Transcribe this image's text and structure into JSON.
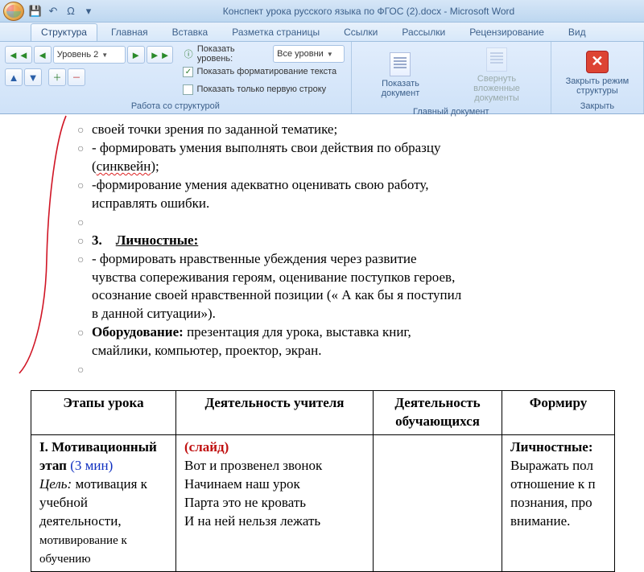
{
  "title": "Конспект урока русского языка по ФГОС (2).docx - Microsoft Word",
  "qat": {
    "save": "💾",
    "undo": "↶",
    "redo": "Ω",
    "dd": "▾"
  },
  "tabs": [
    "Структура",
    "Главная",
    "Вставка",
    "Разметка страницы",
    "Ссылки",
    "Рассылки",
    "Рецензирование",
    "Вид"
  ],
  "ribbon": {
    "outline_level": "Уровень 2",
    "show_level_label": "Показать уровень:",
    "show_level_value": "Все уровни",
    "show_formatting": "Показать форматирование текста",
    "first_line_only": "Показать только первую строку",
    "group_tools": "Работа со структурой",
    "show_doc": "Показать документ",
    "collapse": "Свернуть вложенные документы",
    "group_master": "Главный документ",
    "close_btn": "Закрыть режим структуры",
    "group_close": "Закрыть"
  },
  "doc": {
    "line1": "своей точки зрения по заданной тематике;",
    "line2a": "- формировать умения выполнять свои действия по образцу (",
    "line2b": "синквейн",
    "line2c": ");",
    "line3": "-формирование умения адекватно оценивать свою работу, исправлять ошибки.",
    "sec_num": "3.",
    "sec_title": "Личностные:",
    "line4": "- формировать нравственные убеждения через развитие чувства сопереживания героям, оценивание поступков героев, осознание своей нравственной позиции (« А как бы я поступил в данной ситуации»).",
    "equip_label": "Оборудование:",
    "equip_text": " презентация для урока, выставка книг, смайлики, компьютер, проектор, экран."
  },
  "table": {
    "h1": "Этапы урока",
    "h2": "Деятельность учителя",
    "h3": "Деятельность обучающихся",
    "h4": "Формиру",
    "r1c1a": "I. Мотивационный этап",
    "r1c1b": " (3 мин)",
    "r1c1c": "Цель:",
    "r1c1d": " мотивация к учебной деятельности, ",
    "r1c1e": "мотивирование к обучению",
    "r1c2a": "(слайд)",
    "r1c2b": "Вот и прозвенел звонок",
    "r1c2c": "Начинаем наш урок",
    "r1c2d": "Парта это не кровать",
    "r1c2e": "И на ней нельзя лежать",
    "r1c4a": "Личностные:",
    "r1c4b": "Выражать пол",
    "r1c4c": "отношение к п",
    "r1c4d": "познания, про",
    "r1c4e": "внимание."
  }
}
